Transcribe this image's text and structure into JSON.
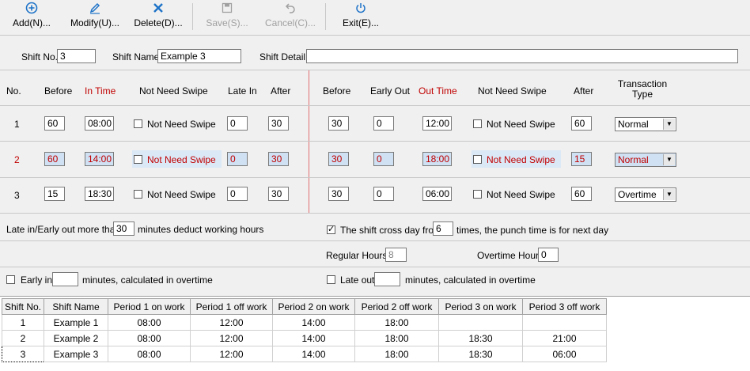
{
  "toolbar": {
    "add": "Add(N)...",
    "modify": "Modify(U)...",
    "delete": "Delete(D)...",
    "save": "Save(S)...",
    "cancel": "Cancel(C)...",
    "exit": "Exit(E)..."
  },
  "header": {
    "shift_no_label": "Shift No.",
    "shift_no": "3",
    "shift_name_label": "Shift Name",
    "shift_name": "Example 3",
    "shift_detail_label": "Shift Detail",
    "shift_detail": ""
  },
  "columns": {
    "no": "No.",
    "before": "Before",
    "in_time": "In Time",
    "not_need_swipe": "Not Need Swipe",
    "late_in": "Late In",
    "after": "After",
    "before2": "Before",
    "early_out": "Early Out",
    "out_time": "Out Time",
    "not_need_swipe2": "Not Need Swipe",
    "after2": "After",
    "transaction_type": "Transaction Type"
  },
  "periods": [
    {
      "no": "1",
      "before": "60",
      "in_time": "08:00",
      "nns_label": "Not Need Swipe",
      "late_in": "0",
      "after": "30",
      "before2": "30",
      "early_out": "0",
      "out_time": "12:00",
      "nns2_label": "Not Need Swipe",
      "after2": "60",
      "type": "Normal"
    },
    {
      "no": "2",
      "before": "60",
      "in_time": "14:00",
      "nns_label": "Not Need Swipe",
      "late_in": "0",
      "after": "30",
      "before2": "30",
      "early_out": "0",
      "out_time": "18:00",
      "nns2_label": "Not Need Swipe",
      "after2": "15",
      "type": "Normal"
    },
    {
      "no": "3",
      "before": "15",
      "in_time": "18:30",
      "nns_label": "Not Need Swipe",
      "late_in": "0",
      "after": "30",
      "before2": "30",
      "early_out": "0",
      "out_time": "06:00",
      "nns2_label": "Not Need Swipe",
      "after2": "60",
      "type": "Overtime"
    }
  ],
  "options": {
    "late_early_prefix": "Late in/Early out more than:",
    "late_early_value": "30",
    "late_early_suffix": "minutes deduct working hours",
    "cross_day_prefix": "The shift cross day from",
    "cross_day_value": "6",
    "cross_day_suffix": "times, the punch time is for next day",
    "regular_hours_label": "Regular Hours",
    "regular_hours": "8",
    "overtime_hours_label": "Overtime Hours",
    "overtime_hours": "0",
    "early_in_label": "Early in",
    "early_in_suffix": "minutes, calculated in overtime",
    "late_out_label": "Late out",
    "late_out_suffix": "minutes, calculated in overtime"
  },
  "grid": {
    "headers": [
      "Shift No.",
      "Shift Name",
      "Period 1 on work",
      "Period 1 off work",
      "Period 2 on work",
      "Period 2 off work",
      "Period 3 on work",
      "Period 3 off work"
    ],
    "rows": [
      [
        "1",
        "Example 1",
        "08:00",
        "12:00",
        "14:00",
        "18:00",
        "",
        ""
      ],
      [
        "2",
        "Example 2",
        "08:00",
        "12:00",
        "14:00",
        "18:00",
        "18:30",
        "21:00"
      ],
      [
        "3",
        "Example 3",
        "08:00",
        "12:00",
        "14:00",
        "18:00",
        "18:30",
        "06:00"
      ]
    ]
  },
  "colors": {
    "accent": "#1e73c8",
    "red": "#c00000",
    "selected_row_bg": "#cfe1f3"
  }
}
